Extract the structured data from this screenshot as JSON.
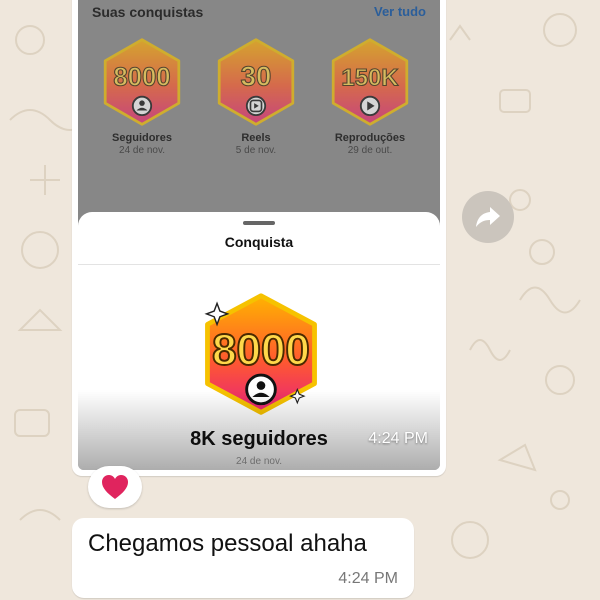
{
  "achievements_screen": {
    "section_title": "Suas conquistas",
    "see_all_label": "Ver tudo",
    "badges": [
      {
        "number": "8000",
        "name": "Seguidores",
        "date": "24 de nov.",
        "icon": "person-icon"
      },
      {
        "number": "30",
        "name": "Reels",
        "date": "5 de nov.",
        "icon": "reels-icon"
      },
      {
        "number": "150K",
        "name": "Reproduções",
        "date": "29 de out.",
        "icon": "play-icon"
      }
    ]
  },
  "sheet": {
    "title": "Conquista",
    "badge_number": "8000",
    "caption": "8K seguidores",
    "subcaption": "24 de nov."
  },
  "image_message": {
    "time": "4:24 PM"
  },
  "reaction": {
    "emoji": "❤️"
  },
  "text_message": {
    "text": "Chegamos pessoal ahaha",
    "time": "4:24 PM"
  },
  "colors": {
    "wallpaper": "#efe7dc",
    "bubble": "#ffffff",
    "badge_gradient_top": "#ffb300",
    "badge_gradient_bottom": "#ff2d6f",
    "badge_number_fill": "#ffd84a",
    "heart": "#e0245e"
  }
}
